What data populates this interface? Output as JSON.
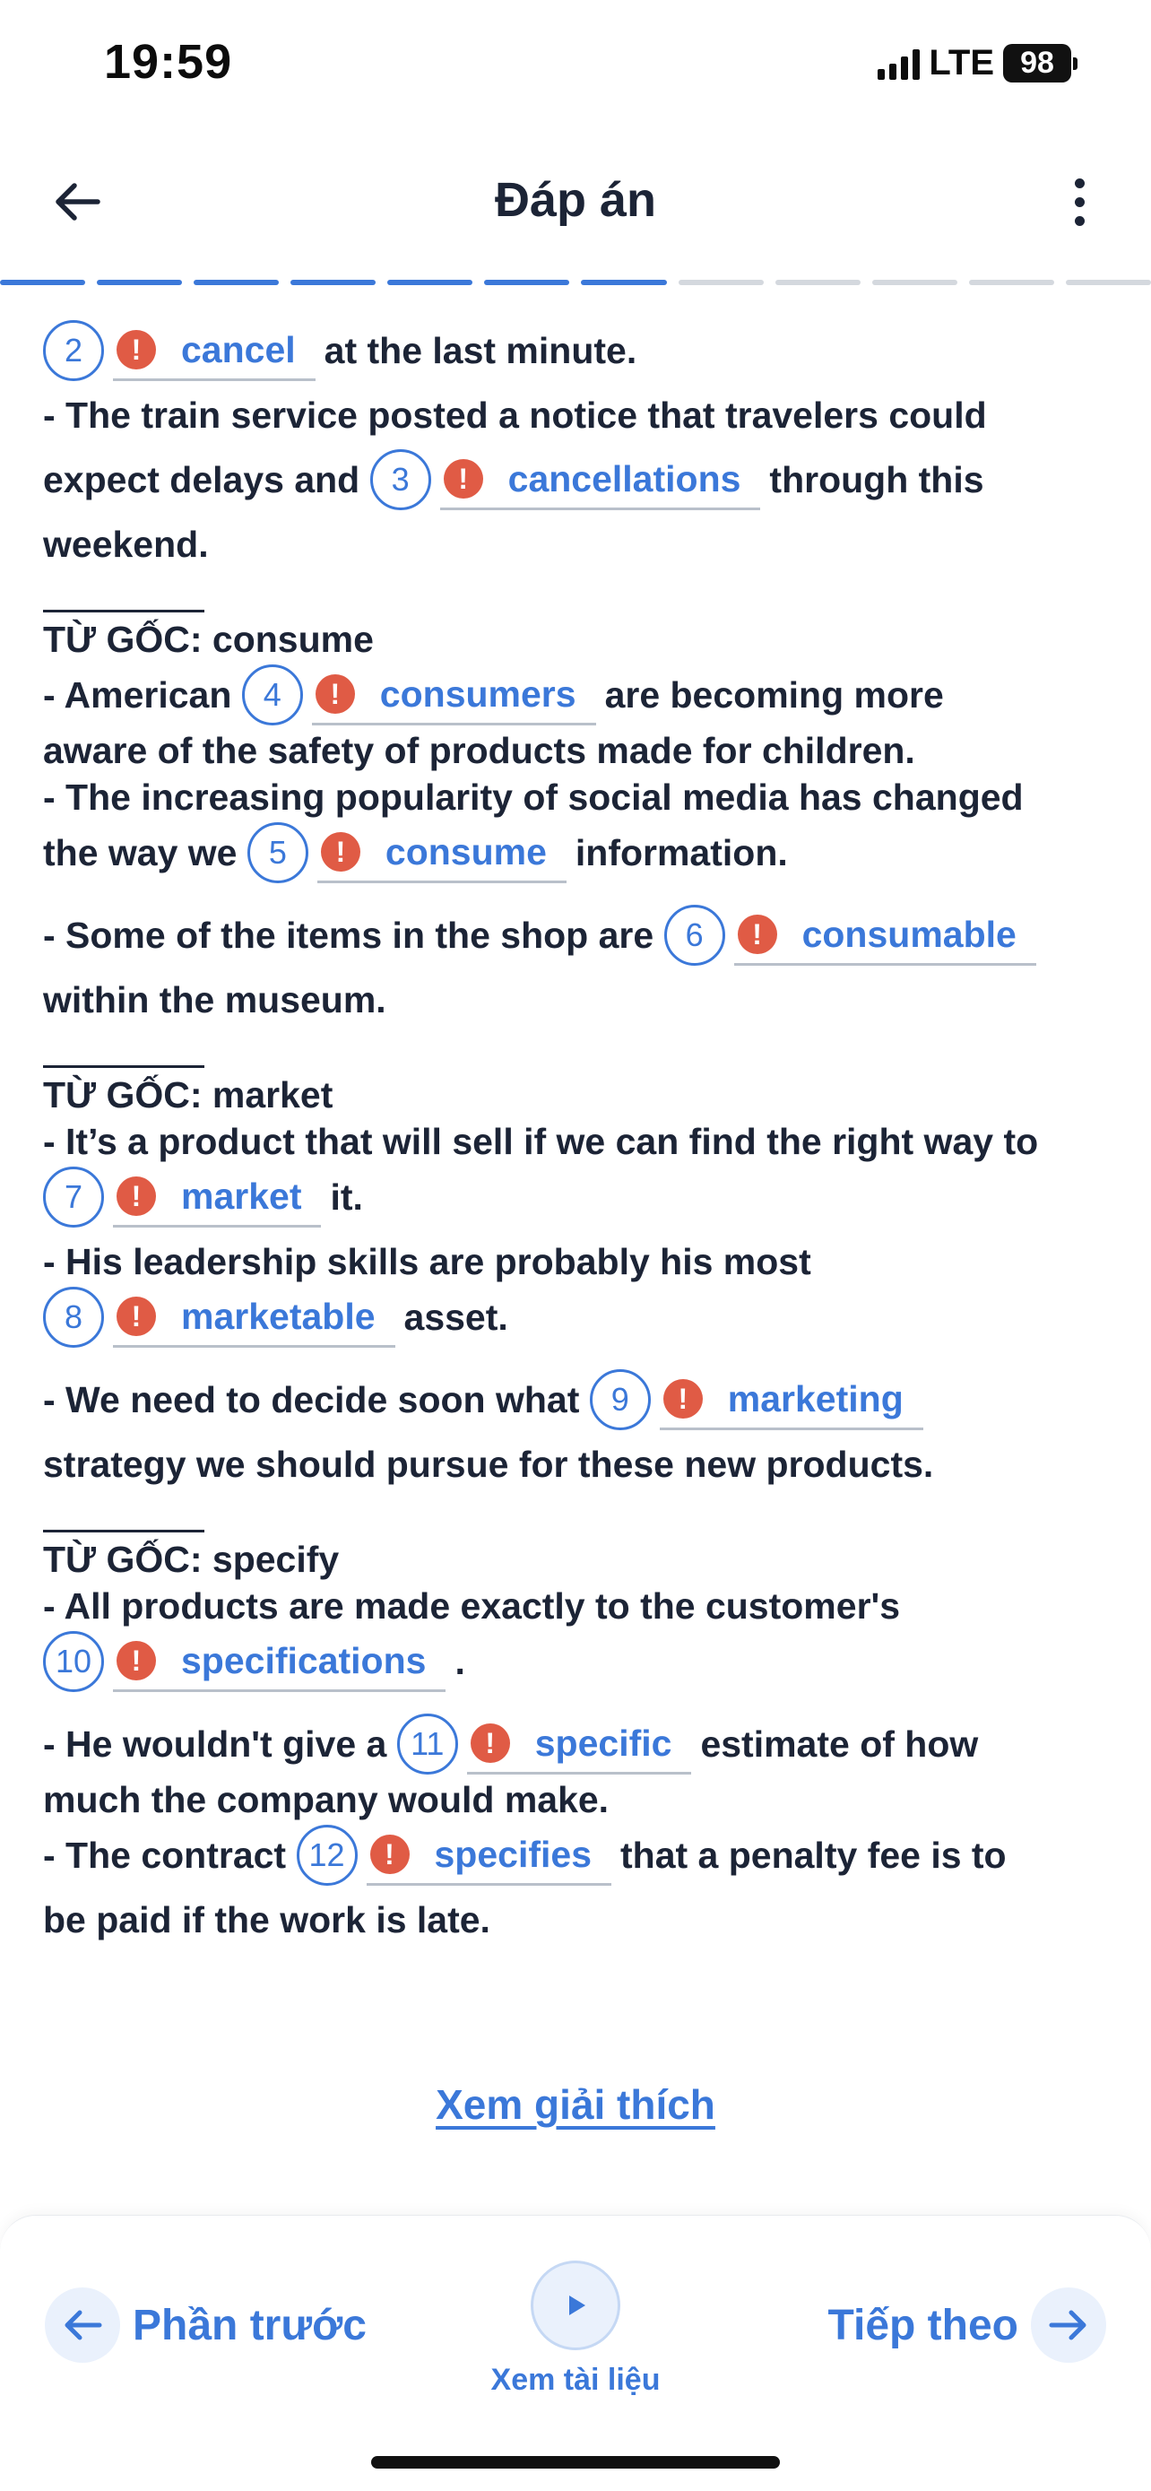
{
  "status_bar": {
    "time": "19:59",
    "network": "LTE",
    "battery": "98"
  },
  "header": {
    "title": "Đáp án"
  },
  "progress": {
    "total": 12,
    "completed": 7
  },
  "content": {
    "line_2": {
      "num": "2",
      "answer": "cancel",
      "after": "at the last minute."
    },
    "line_train_1": "- The train service posted a notice that travelers could",
    "line_train_2": {
      "before": "expect delays and",
      "num": "3",
      "answer": "cancellations",
      "after": "through this"
    },
    "line_train_3": "weekend.",
    "root_consume": {
      "label": "TỪ GỐC:",
      "word": "consume"
    },
    "line_4": {
      "before": "- American",
      "num": "4",
      "answer": "consumers",
      "after": "are becoming more"
    },
    "line_4b": "aware of the safety of products made for children.",
    "line_5a": "- The increasing popularity of social media has changed",
    "line_5": {
      "before": "the way we",
      "num": "5",
      "answer": "consume",
      "after": "information."
    },
    "line_6": {
      "before": "- Some of the items in the shop are",
      "num": "6",
      "answer": "consumable",
      "after": ""
    },
    "line_6b": "within the museum.",
    "root_market": {
      "label": "TỪ GỐC:",
      "word": "market"
    },
    "line_7a": "- It’s a product that will sell if we can find the right way to",
    "line_7": {
      "num": "7",
      "answer": "market",
      "after": "it."
    },
    "line_8a": "- His leadership skills are probably his most",
    "line_8": {
      "num": "8",
      "answer": "marketable",
      "after": "asset."
    },
    "line_9": {
      "before": "- We need to decide soon what",
      "num": "9",
      "answer": "marketing",
      "after": ""
    },
    "line_9b": "strategy we should pursue for these new products.",
    "root_specify": {
      "label": "TỪ GỐC:",
      "word": "specify"
    },
    "line_10a": "- All products are made exactly to the customer's",
    "line_10": {
      "num": "10",
      "answer": "specifications",
      "after": "."
    },
    "line_11": {
      "before": "- He wouldn't give a",
      "num": "11",
      "answer": "specific",
      "after": "estimate of how"
    },
    "line_11b": "much the company would make.",
    "line_12": {
      "before": "- The contract",
      "num": "12",
      "answer": "specifies",
      "after": "that a penalty fee is to"
    },
    "line_12b": "be paid if the work is late."
  },
  "explain_link": "Xem giải thích",
  "footer": {
    "prev_label": "Phần trước",
    "doc_label": "Xem tài liệu",
    "next_label": "Tiếp theo"
  },
  "colors": {
    "accent": "#3b78d9",
    "error": "#e05b45",
    "text": "#1c2436"
  },
  "icons": {
    "back": "arrow-left-icon",
    "more": "more-vertical-icon",
    "alert": "alert-icon",
    "play": "play-icon",
    "next": "arrow-right-icon"
  }
}
